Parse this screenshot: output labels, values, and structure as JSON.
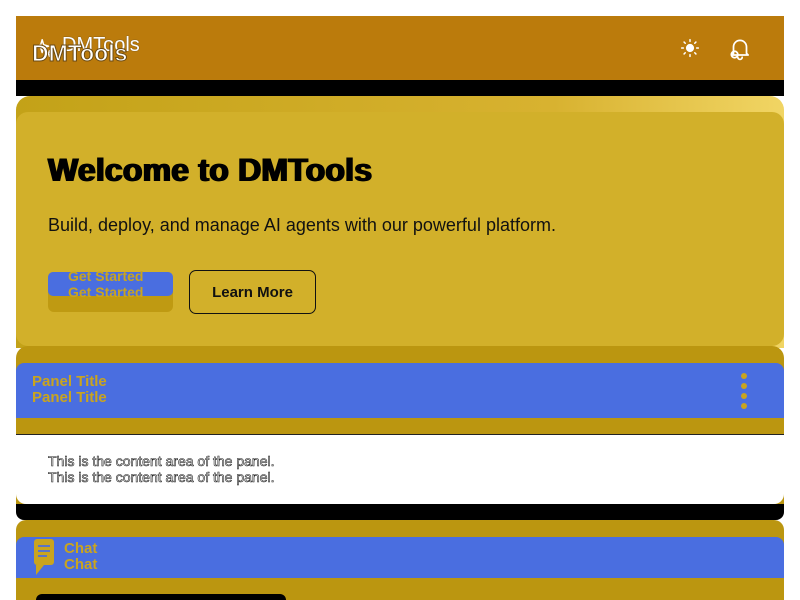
{
  "app": {
    "name": "DMTools"
  },
  "header": {
    "brand_icon": "sparkles-icon",
    "theme_icon": "sun-icon",
    "notify_icon": "bell-icon"
  },
  "hero": {
    "title": "Welcome to DMTools",
    "subtitle": "Build, deploy, and manage AI agents with our powerful platform.",
    "primary_label": "Get Started",
    "secondary_label": "Learn More"
  },
  "panel": {
    "title": "Panel Title",
    "body": "This is the content area of the panel.",
    "menu_icon": "kebab-menu-icon"
  },
  "chat": {
    "label": "Chat",
    "icon": "chat-icon"
  },
  "colors": {
    "header_bg": "#bb7b0c",
    "hero_bg": "#d2b02a",
    "accent_blue": "#4a6ee0",
    "gold_text": "#c9a41f"
  }
}
